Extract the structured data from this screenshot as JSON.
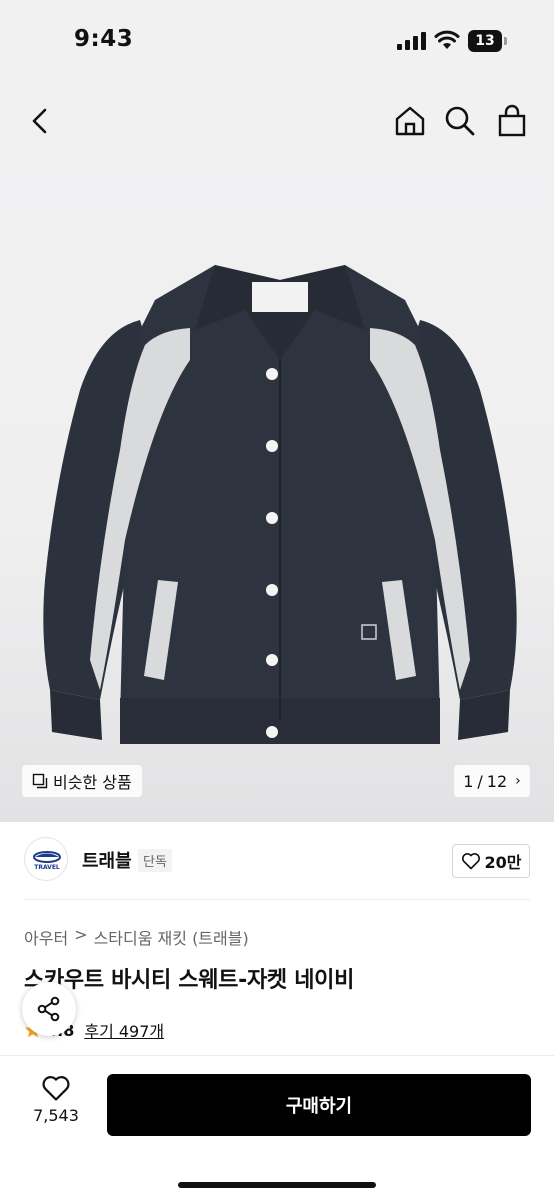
{
  "status_bar": {
    "time": "9:43",
    "battery": "13"
  },
  "gallery": {
    "similar_label": "비슷한 상품",
    "current_page": "1",
    "total_pages": "12"
  },
  "brand": {
    "name": "트래블",
    "tag": "단독",
    "likes": "20만",
    "logo_text": "TRAVEL"
  },
  "product": {
    "breadcrumb": [
      "아우터",
      "스타디움 재킷 (트래블)"
    ],
    "title": "스카우트 바시티 스웨트-자켓 네이비",
    "rating": "4.8",
    "reviews": "후기 497개"
  },
  "bottom": {
    "wish_count": "7,543",
    "buy_label": "구매하기"
  },
  "colors": {
    "jacket_navy": "#2c323d",
    "jacket_grey": "#d9dadc",
    "star": "#f5a623",
    "button": "#000000"
  }
}
